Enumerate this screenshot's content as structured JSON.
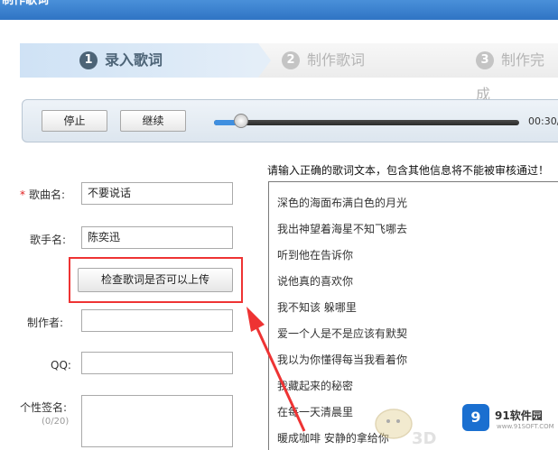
{
  "window": {
    "title": "制作歌词"
  },
  "steps": [
    {
      "num": "1",
      "label": "录入歌词"
    },
    {
      "num": "2",
      "label": "制作歌词"
    },
    {
      "num": "3",
      "label": "制作完成"
    }
  ],
  "player": {
    "stop_label": "停止",
    "continue_label": "继续",
    "time": "00:30/",
    "progress": 0.09
  },
  "hint": "请输入正确的歌词文本，包含其他信息将不能被审核通过！",
  "form": {
    "song_label": "歌曲名:",
    "song_value": "不要说话",
    "singer_label": "歌手名:",
    "singer_value": "陈奕迅",
    "check_button": "检查歌词是否可以上传",
    "maker_label": "制作者:",
    "qq_label": "QQ:",
    "signature_label": "个性签名:",
    "signature_count": "(0/20)"
  },
  "lyrics": [
    "深色的海面布满白色的月光",
    "我出神望着海星不知飞哪去",
    "听到他在告诉你",
    "说他真的喜欢你",
    "我不知该 躲哪里",
    "爱一个人是不是应该有默契",
    "我以为你懂得每当我看着你",
    "我藏起来的秘密",
    "在每一天清晨里",
    "暖成咖啡 安静的拿给你"
  ],
  "watermark": {
    "logo": "9",
    "name": "91软件园",
    "url": "www.91SOFT.COM",
    "mark": "3D"
  },
  "colors": {
    "accent": "#3f8fe0",
    "highlight": "#e33333",
    "title_bar": "#2f74c4"
  }
}
